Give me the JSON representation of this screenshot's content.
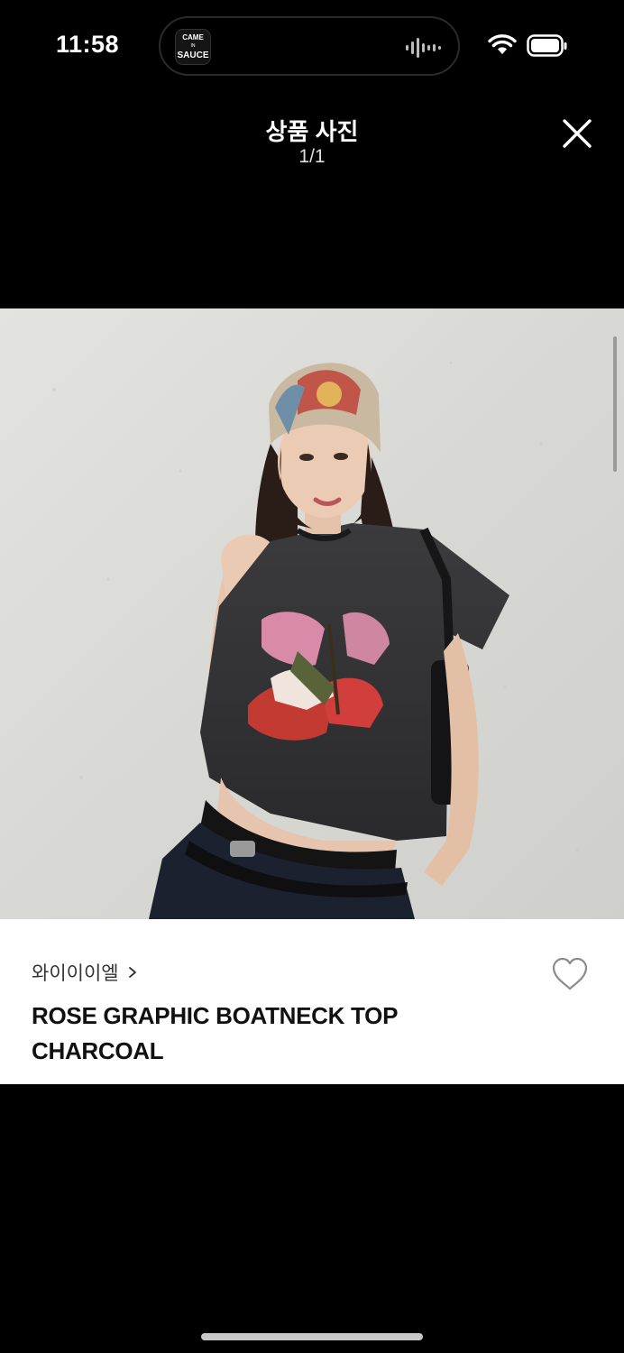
{
  "status_bar": {
    "time": "11:58",
    "island_thumb_line1": "CAME",
    "island_thumb_line2": "IN",
    "island_thumb_line3": "SAUCE"
  },
  "header": {
    "title": "상품 사진",
    "counter": "1/1"
  },
  "product": {
    "brand": "와이이이엘",
    "name_line1": "ROSE GRAPHIC BOATNECK TOP",
    "name_line2": "CHARCOAL"
  },
  "icons": {
    "close": "close-icon",
    "heart": "heart-outline-icon",
    "chevron": "chevron-right-icon"
  }
}
